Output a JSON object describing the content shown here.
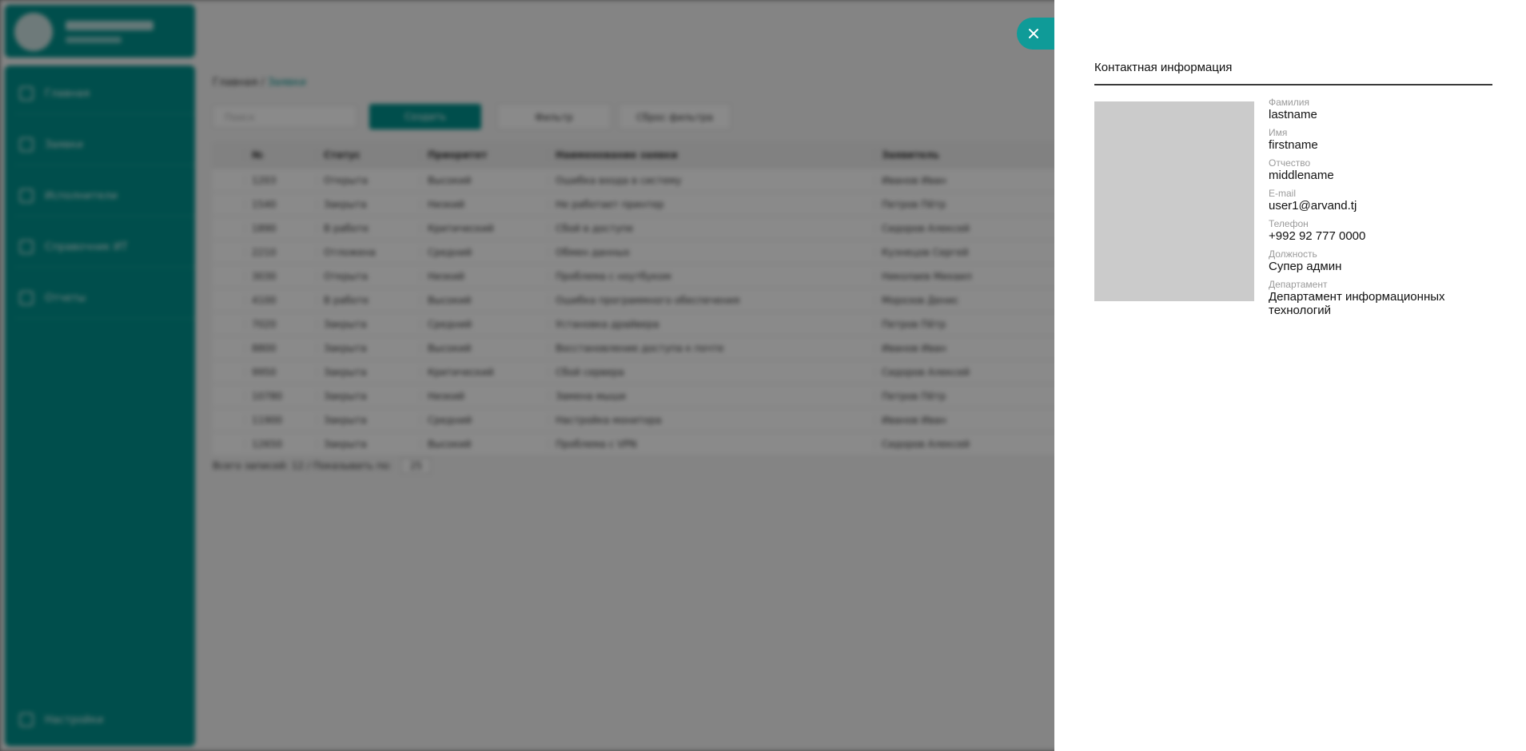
{
  "background_app": {
    "sidebar_items": [
      "Главная",
      "Заявки",
      "Исполнители",
      "Справочник ИТ",
      "Отчеты"
    ],
    "settings_label": "Настройки",
    "breadcrumb": {
      "home": "Главная",
      "current": "Заявки"
    },
    "search_placeholder": "Поиск",
    "buttons": {
      "create": "Создать",
      "filter": "Фильтр",
      "reset": "Сброс фильтра"
    },
    "table": {
      "headers": [
        "",
        "№",
        "Статус",
        "Приоритет",
        "Наименование заявки",
        "Заявитель"
      ],
      "rows": [
        [
          "",
          "1203",
          "Открыта",
          "Высокий",
          "Ошибка входа в систему",
          "Иванов Иван"
        ],
        [
          "",
          "1540",
          "Закрыта",
          "Низкий",
          "Не работает принтер",
          "Петров Пётр"
        ],
        [
          "",
          "1890",
          "В работе",
          "Критический",
          "Сбой в доступе",
          "Сидоров Алексей"
        ],
        [
          "",
          "2210",
          "Отложена",
          "Средний",
          "Обмен данных",
          "Кузнецов Сергей"
        ],
        [
          "",
          "3030",
          "Открыта",
          "Низкий",
          "Проблема с ноутбуком",
          "Николаев Михаил"
        ],
        [
          "",
          "4100",
          "В работе",
          "Высокий",
          "Ошибка программного обеспечения",
          "Морозов Денис"
        ],
        [
          "",
          "7020",
          "Закрыта",
          "Средний",
          "Установка драйвера",
          "Петров Пётр"
        ],
        [
          "",
          "8800",
          "Закрыта",
          "Высокий",
          "Восстановление доступа к почте",
          "Иванов Иван"
        ],
        [
          "",
          "9950",
          "Закрыта",
          "Критический",
          "Сбой сервера",
          "Сидоров Алексей"
        ],
        [
          "",
          "10780",
          "Закрыта",
          "Низкий",
          "Замена мыши",
          "Петров Пётр"
        ],
        [
          "",
          "11900",
          "Закрыта",
          "Средний",
          "Настройка монитора",
          "Иванов Иван"
        ],
        [
          "",
          "12650",
          "Закрыта",
          "Высокий",
          "Проблема с VPN",
          "Сидоров Алексей"
        ]
      ]
    },
    "pager": {
      "text": "Всего записей: 12 / Показывать по:",
      "per_page": "25"
    }
  },
  "drawer": {
    "title": "Контактная информация",
    "fields": [
      {
        "label": "Фамилия",
        "value": "lastname"
      },
      {
        "label": "Имя",
        "value": "firstname"
      },
      {
        "label": "Отчество",
        "value": "middlename"
      },
      {
        "label": "E-mail",
        "value": "user1@arvand.tj"
      },
      {
        "label": "Телефон",
        "value": "+992 92 777 0000"
      },
      {
        "label": "Должность",
        "value": "Супер админ"
      },
      {
        "label": "Департамент",
        "value": "Департамент информационных технологий"
      }
    ]
  },
  "colors": {
    "accent": "#0f9b98",
    "photo_placeholder": "#cbcbcb",
    "overlay": "rgba(0,0,0,0.46)"
  },
  "icons": {
    "close": "close-icon"
  }
}
